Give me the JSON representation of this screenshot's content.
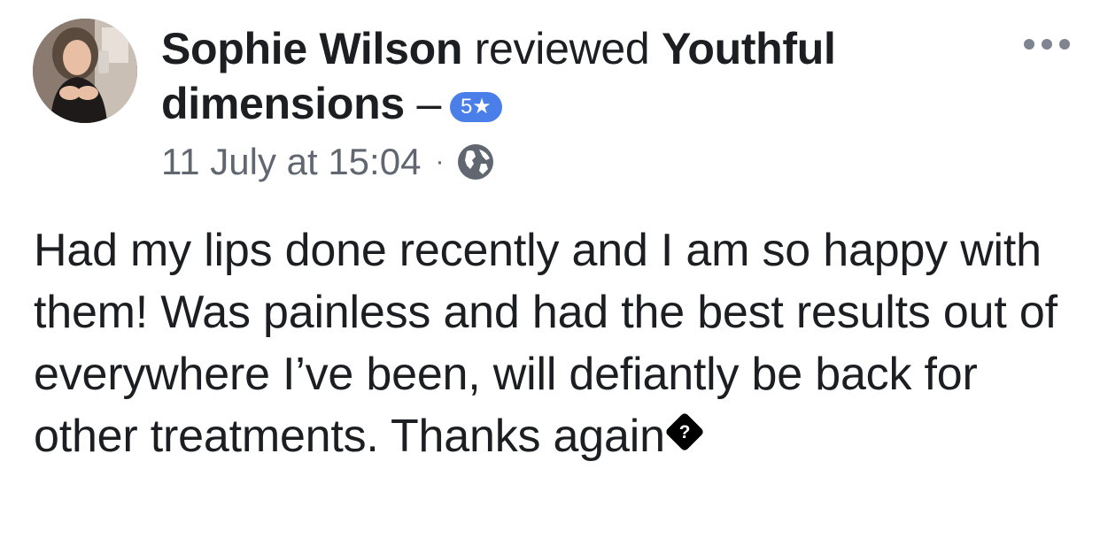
{
  "review": {
    "reviewer_name": "Sophie Wilson",
    "verb": "reviewed",
    "page_name": "Youthful dimensions",
    "dash": "–",
    "rating_badge": "5★",
    "timestamp": "11 July at 15:04",
    "separator": "·",
    "privacy_icon": "globe-icon",
    "more_icon": "more-options-icon",
    "body_text": "Had my lips done recently and I am so happy with them! Was painless and had the best results out of everywhere I’ve been, will defiantly be back for other treatments. Thanks again",
    "emoji_fallback_glyph": "?"
  },
  "colors": {
    "text_primary": "#1c1e21",
    "text_secondary": "#606770",
    "badge_blue": "#4a7ee8",
    "icon_gray": "#7f8590",
    "background": "#ffffff"
  }
}
